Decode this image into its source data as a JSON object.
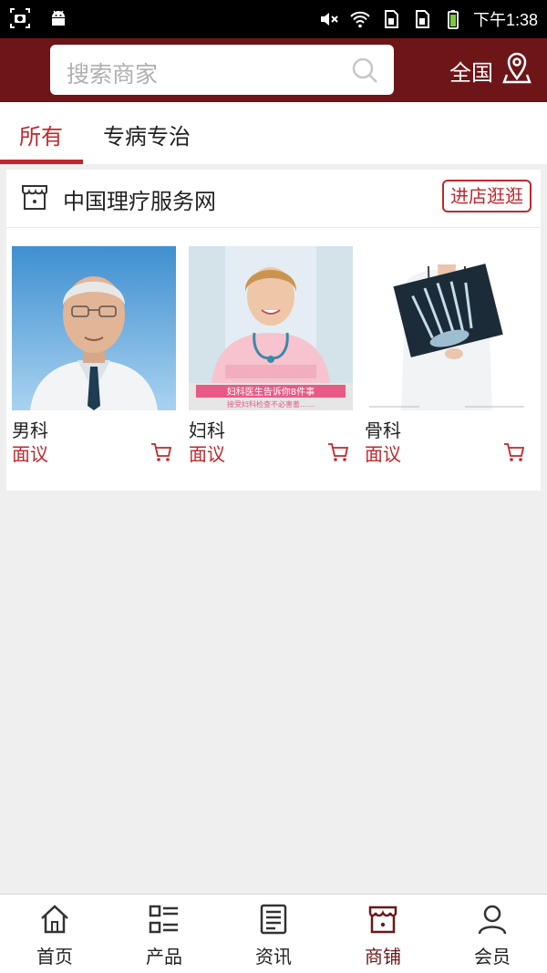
{
  "status_bar": {
    "time": "下午1:38"
  },
  "header": {
    "search_placeholder": "搜索商家",
    "region": "全国"
  },
  "tabs": [
    {
      "label": "所有",
      "active": true
    },
    {
      "label": "专病专治",
      "active": false
    }
  ],
  "shop": {
    "name": "中国理疗服务网",
    "enter_label": "进店逛逛"
  },
  "products": [
    {
      "name": "男科",
      "price": "面议"
    },
    {
      "name": "妇科",
      "price": "面议",
      "banner_line1": "妇科医生告诉你8件事",
      "banner_line2": "接受妇科检查不必害羞……"
    },
    {
      "name": "骨科",
      "price": "面议"
    }
  ],
  "bottom_nav": [
    {
      "label": "首页",
      "icon": "home-icon"
    },
    {
      "label": "产品",
      "icon": "list-icon"
    },
    {
      "label": "资讯",
      "icon": "news-icon"
    },
    {
      "label": "商铺",
      "icon": "store-icon",
      "active": true
    },
    {
      "label": "会员",
      "icon": "user-icon"
    }
  ],
  "colors": {
    "brand": "#6e1518",
    "accent": "#c1272d"
  }
}
